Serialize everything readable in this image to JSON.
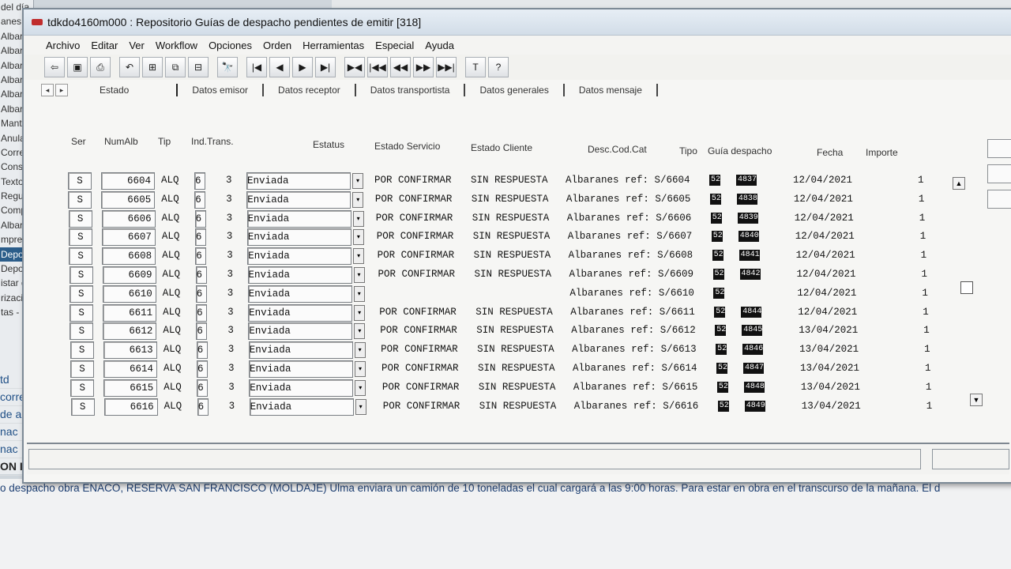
{
  "background": {
    "left_list": [
      "del día",
      "anes",
      "Albará",
      "Albará",
      "Albará",
      "Albará",
      "Albará",
      "Albará",
      "Mante",
      "Anulac",
      "Correc",
      "Consul",
      "Textos",
      "Regula",
      "Compe",
      "Albara",
      "mpres",
      "Depos",
      "Depos",
      "istar d",
      "rizaci",
      "tas - I"
    ],
    "left_list_selected_index": 17,
    "left_bottom": [
      "td",
      "corre",
      "de a",
      "nac",
      "nac",
      "ON I"
    ],
    "note": "o despacho obra ENACO, RESERVA SAN FRANCISCO (MOLDAJE) Ulma enviara un camión de  10 toneladas el cual cargará a las 9:00 horas. Para estar en obra en el transcurso de la mañana. El d"
  },
  "window": {
    "title": "tdkdo4160m000 : Repositorio Guías de despacho pendientes de emitir [318]"
  },
  "menu": [
    "Archivo",
    "Editar",
    "Ver",
    "Workflow",
    "Opciones",
    "Orden",
    "Herramientas",
    "Especial",
    "Ayuda"
  ],
  "toolbar": [
    {
      "name": "exit-icon",
      "glyph": "⇦"
    },
    {
      "name": "save-icon",
      "glyph": "▣"
    },
    {
      "name": "print-icon",
      "glyph": "⎙"
    },
    {
      "name": "undo-icon",
      "glyph": "↶"
    },
    {
      "name": "tree-icon",
      "glyph": "⊞"
    },
    {
      "name": "copy-icon",
      "glyph": "⧉"
    },
    {
      "name": "hierarchy-icon",
      "glyph": "⊟"
    },
    {
      "name": "find-icon",
      "glyph": "🔭"
    },
    {
      "name": "first-record-icon",
      "glyph": "|◀"
    },
    {
      "name": "previous-record-icon",
      "glyph": "◀"
    },
    {
      "name": "next-record-icon",
      "glyph": "▶"
    },
    {
      "name": "last-record-icon",
      "glyph": "▶|"
    },
    {
      "name": "first-group-icon",
      "glyph": "▶◀"
    },
    {
      "name": "first-page-icon",
      "glyph": "|◀◀"
    },
    {
      "name": "previous-page-icon",
      "glyph": "◀◀"
    },
    {
      "name": "next-page-icon",
      "glyph": "▶▶"
    },
    {
      "name": "last-page-icon",
      "glyph": "▶▶|"
    },
    {
      "name": "text-icon",
      "glyph": "T"
    },
    {
      "name": "help-icon",
      "glyph": "?"
    }
  ],
  "tabs": [
    "Estado",
    "Datos emisor",
    "Datos receptor",
    "Datos transportista",
    "Datos generales",
    "Datos mensaje"
  ],
  "columns": {
    "ser": "Ser",
    "numalb": "NumAlb",
    "tip": "Tip",
    "indtrans": "Ind.Trans.",
    "estatus": "Estatus",
    "estado_servicio": "Estado Servicio",
    "estado_cliente": "Estado Cliente",
    "desc": "Desc.Cod.Cat",
    "tipo": "Tipo",
    "guia": "Guía despacho",
    "fecha": "Fecha",
    "importe": "Importe"
  },
  "rows": [
    {
      "ser": "S",
      "num": "6604",
      "tip": "ALQ",
      "ind": "6",
      "n": "3",
      "estatus": "Enviada",
      "serv": "POR CONFIRMAR",
      "cli": "SIN RESPUESTA",
      "desc": "Albaranes ref: S/6604",
      "tipo": "52",
      "guia": "4837",
      "fecha": "12/04/2021",
      "imp": "1"
    },
    {
      "ser": "S",
      "num": "6605",
      "tip": "ALQ",
      "ind": "6",
      "n": "3",
      "estatus": "Enviada",
      "serv": "POR CONFIRMAR",
      "cli": "SIN RESPUESTA",
      "desc": "Albaranes ref: S/6605",
      "tipo": "52",
      "guia": "4838",
      "fecha": "12/04/2021",
      "imp": "1"
    },
    {
      "ser": "S",
      "num": "6606",
      "tip": "ALQ",
      "ind": "6",
      "n": "3",
      "estatus": "Enviada",
      "serv": "POR CONFIRMAR",
      "cli": "SIN RESPUESTA",
      "desc": "Albaranes ref: S/6606",
      "tipo": "52",
      "guia": "4839",
      "fecha": "12/04/2021",
      "imp": "1"
    },
    {
      "ser": "S",
      "num": "6607",
      "tip": "ALQ",
      "ind": "6",
      "n": "3",
      "estatus": "Enviada",
      "serv": "POR CONFIRMAR",
      "cli": "SIN RESPUESTA",
      "desc": "Albaranes ref: S/6607",
      "tipo": "52",
      "guia": "4840",
      "fecha": "12/04/2021",
      "imp": "1"
    },
    {
      "ser": "S",
      "num": "6608",
      "tip": "ALQ",
      "ind": "6",
      "n": "3",
      "estatus": "Enviada",
      "serv": "POR CONFIRMAR",
      "cli": "SIN RESPUESTA",
      "desc": "Albaranes ref: S/6608",
      "tipo": "52",
      "guia": "4841",
      "fecha": "12/04/2021",
      "imp": "1"
    },
    {
      "ser": "S",
      "num": "6609",
      "tip": "ALQ",
      "ind": "6",
      "n": "3",
      "estatus": "Enviada",
      "serv": "POR CONFIRMAR",
      "cli": "SIN RESPUESTA",
      "desc": "Albaranes ref: S/6609",
      "tipo": "52",
      "guia": "4842",
      "fecha": "12/04/2021",
      "imp": "1"
    },
    {
      "ser": "S",
      "num": "6610",
      "tip": "ALQ",
      "ind": "6",
      "n": "3",
      "estatus": "Enviada",
      "serv": "",
      "cli": "",
      "desc": "Albaranes ref: S/6610",
      "tipo": "52",
      "guia": "",
      "fecha": "12/04/2021",
      "imp": "1"
    },
    {
      "ser": "S",
      "num": "6611",
      "tip": "ALQ",
      "ind": "6",
      "n": "3",
      "estatus": "Enviada",
      "serv": "POR CONFIRMAR",
      "cli": "SIN RESPUESTA",
      "desc": "Albaranes ref: S/6611",
      "tipo": "52",
      "guia": "4844",
      "fecha": "12/04/2021",
      "imp": "1"
    },
    {
      "ser": "S",
      "num": "6612",
      "tip": "ALQ",
      "ind": "6",
      "n": "3",
      "estatus": "Enviada",
      "serv": "POR CONFIRMAR",
      "cli": "SIN RESPUESTA",
      "desc": "Albaranes ref: S/6612",
      "tipo": "52",
      "guia": "4845",
      "fecha": "13/04/2021",
      "imp": "1"
    },
    {
      "ser": "S",
      "num": "6613",
      "tip": "ALQ",
      "ind": "6",
      "n": "3",
      "estatus": "Enviada",
      "serv": "POR CONFIRMAR",
      "cli": "SIN RESPUESTA",
      "desc": "Albaranes ref: S/6613",
      "tipo": "52",
      "guia": "4846",
      "fecha": "13/04/2021",
      "imp": "1"
    },
    {
      "ser": "S",
      "num": "6614",
      "tip": "ALQ",
      "ind": "6",
      "n": "3",
      "estatus": "Enviada",
      "serv": "POR CONFIRMAR",
      "cli": "SIN RESPUESTA",
      "desc": "Albaranes ref: S/6614",
      "tipo": "52",
      "guia": "4847",
      "fecha": "13/04/2021",
      "imp": "1"
    },
    {
      "ser": "S",
      "num": "6615",
      "tip": "ALQ",
      "ind": "6",
      "n": "3",
      "estatus": "Enviada",
      "serv": "POR CONFIRMAR",
      "cli": "SIN RESPUESTA",
      "desc": "Albaranes ref: S/6615",
      "tipo": "52",
      "guia": "4848",
      "fecha": "13/04/2021",
      "imp": "1"
    },
    {
      "ser": "S",
      "num": "6616",
      "tip": "ALQ",
      "ind": "6",
      "n": "3",
      "estatus": "Enviada",
      "serv": "POR CONFIRMAR",
      "cli": "SIN RESPUESTA",
      "desc": "Albaranes ref: S/6616",
      "tipo": "52",
      "guia": "4849",
      "fecha": "13/04/2021",
      "imp": "1"
    }
  ],
  "scroll": {
    "up": "▲",
    "down": "▼"
  },
  "colors": {
    "title_bar": "#d2dde8",
    "badge": "#111111",
    "selected_bg": "#2b5d8a"
  }
}
